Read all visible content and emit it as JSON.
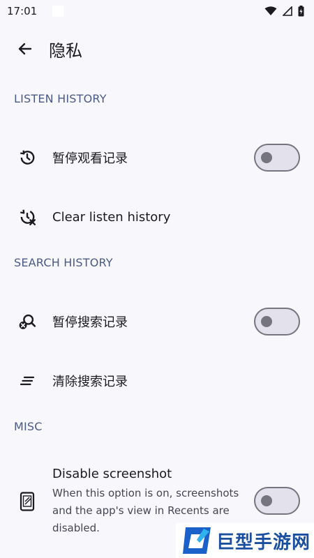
{
  "status_bar": {
    "time": "17:01",
    "icons": [
      "wifi-icon",
      "signal-icon",
      "battery-icon"
    ]
  },
  "header": {
    "back_icon": "arrow-left-icon",
    "title": "隐私"
  },
  "sections": {
    "listen_history": {
      "title": "LISTEN HISTORY",
      "pause_label": "暂停观看记录",
      "pause_icon": "history-icon",
      "pause_toggle_on": false,
      "clear_label": "Clear listen history",
      "clear_icon": "history-clear-icon"
    },
    "search_history": {
      "title": "SEARCH HISTORY",
      "pause_label": "暂停搜索记录",
      "pause_icon": "search-off-icon",
      "pause_toggle_on": false,
      "clear_label": "清除搜索记录",
      "clear_icon": "clear-all-icon"
    },
    "misc": {
      "title": "MISC",
      "screenshot_title": "Disable screenshot",
      "screenshot_desc": "When this option is on, screenshots and the app's view in Recents are disabled.",
      "screenshot_icon": "phone-icon",
      "screenshot_toggle_on": false
    }
  },
  "watermark": {
    "text": "巨型手游网"
  },
  "colors": {
    "background": "#f8f7fc",
    "section_header": "#4a5a86",
    "toggle_outline": "#74757f",
    "toggle_track": "#e2e1ec"
  }
}
